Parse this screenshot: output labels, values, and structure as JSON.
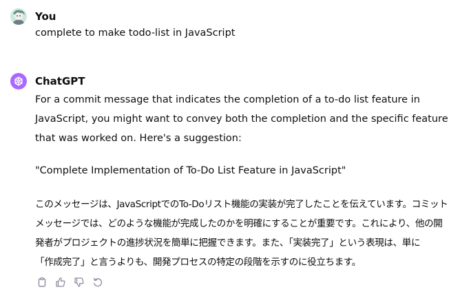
{
  "user_message": {
    "author": "You",
    "text": "complete to make todo-list in JavaScript"
  },
  "assistant_message": {
    "author": "ChatGPT",
    "paragraph1_lines": [
      "For a commit message that indicates the completion of a to-do list feature in",
      "JavaScript, you might want to convey both the completion and the specific feature",
      "that was worked on. Here's a suggestion:"
    ],
    "suggestion": "\"Complete Implementation of To-Do List Feature in JavaScript\"",
    "japanese_lines": [
      "このメッセージは、JavaScriptでのTo-Doリスト機能の実装が完了したことを伝えています。コミット",
      "メッセージでは、どのような機能が完成したのかを明確にすることが重要です。これにより、他の開",
      "発者がプロジェクトの進捗状況を簡単に把握できます。また、「実装完了」という表現は、単に",
      "「作成完了」と言うよりも、開発プロセスの特定の段階を示すのに役立ちます。"
    ],
    "actions": [
      "copy-icon",
      "thumbs-up-icon",
      "thumbs-down-icon",
      "regenerate-icon"
    ]
  },
  "colors": {
    "chatgpt_avatar_bg": "#ab68ff",
    "action_icon": "#8e8ea0"
  }
}
